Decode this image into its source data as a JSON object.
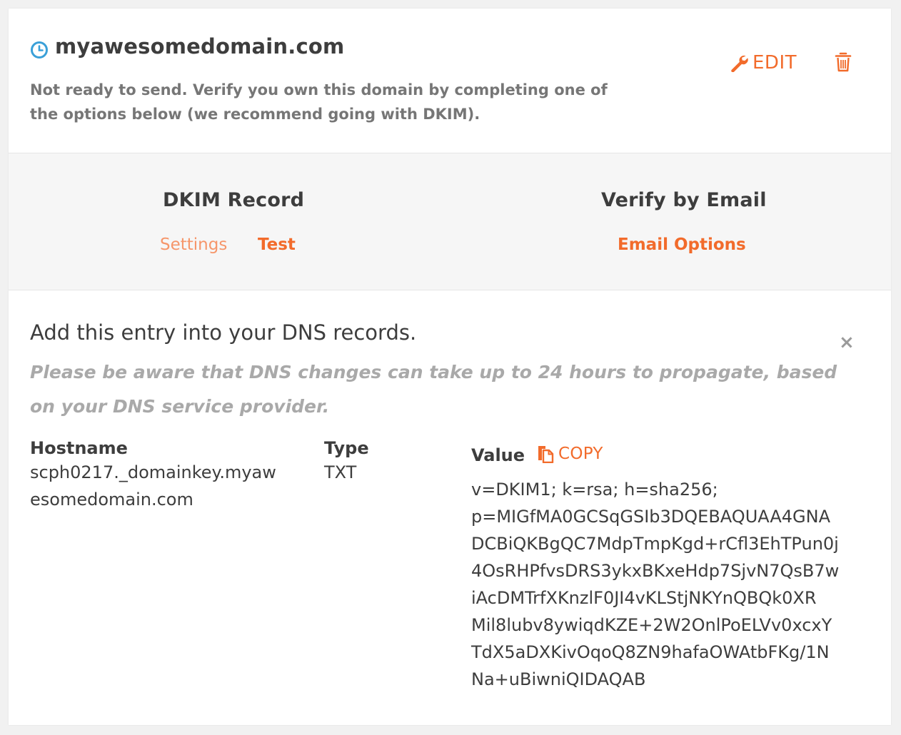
{
  "domain": {
    "name": "myawesomedomain.com",
    "status_text": "Not ready to send. Verify you own this domain by completing one of the options below (we recommend going with DKIM).",
    "status_icon": "clock-icon",
    "edit_label": "EDIT",
    "edit_icon": "wrench-icon",
    "delete_icon": "trash-icon"
  },
  "methods": {
    "dkim": {
      "title": "DKIM Record",
      "tabs": [
        "Settings",
        "Test"
      ]
    },
    "email": {
      "title": "Verify by Email",
      "tabs": [
        "Email Options"
      ]
    }
  },
  "dns": {
    "title": "Add this entry into your DNS records.",
    "note": "Please be aware that DNS changes can take up to 24 hours to propagate, based on your DNS service provider.",
    "close_label": "×",
    "columns": {
      "hostname": "Hostname",
      "type": "Type",
      "value": "Value"
    },
    "copy_label": "COPY",
    "copy_icon": "copy-icon",
    "record": {
      "hostname": "scph0217._domainkey.myawesomedomain.com",
      "type": "TXT",
      "value": "v=DKIM1; k=rsa; h=sha256; p=MIGfMA0GCSqGSIb3DQEBAQUAA4GNADCBiQKBgQC7MdpTmpKgd+rCfl3EhTPun0j4OsRHPfvsDRS3ykxBKxeHdp7SjvN7QsB7wiAcDMTrfXKnzlF0JI4vKLStjNKYnQBQk0XRMil8lubv8ywiqdKZE+2W2OnlPoELVv0xcxYTdX5aDXKivOqoQ8ZN9hafaOWAtbFKg/1NNa+uBiwniQIDAQAB",
      "value_lines": [
        "v=DKIM1; k=rsa; h=sha256;",
        "p=MIGfMA0GCSqGSIb3DQEBAQUAA4GNA",
        "DCBiQKBgQC7MdpTmpKgd+rCfl3EhTPun0j",
        "4OsRHPfvsDRS3ykxBKxeHdp7SjvN7QsB7w",
        "iAcDMTrfXKnzlF0JI4vKLStjNKYnQBQk0XR",
        "Mil8lubv8ywiqdKZE+2W2OnlPoELVv0xcxY",
        "TdX5aDXKivOqoQ8ZN9hafaOWAtbFKg/1N",
        "Na+uBiwniQIDAQAB"
      ]
    }
  },
  "colors": {
    "accent": "#f26b2b",
    "accent_light": "#f6966a",
    "clock": "#3aa0d8"
  }
}
